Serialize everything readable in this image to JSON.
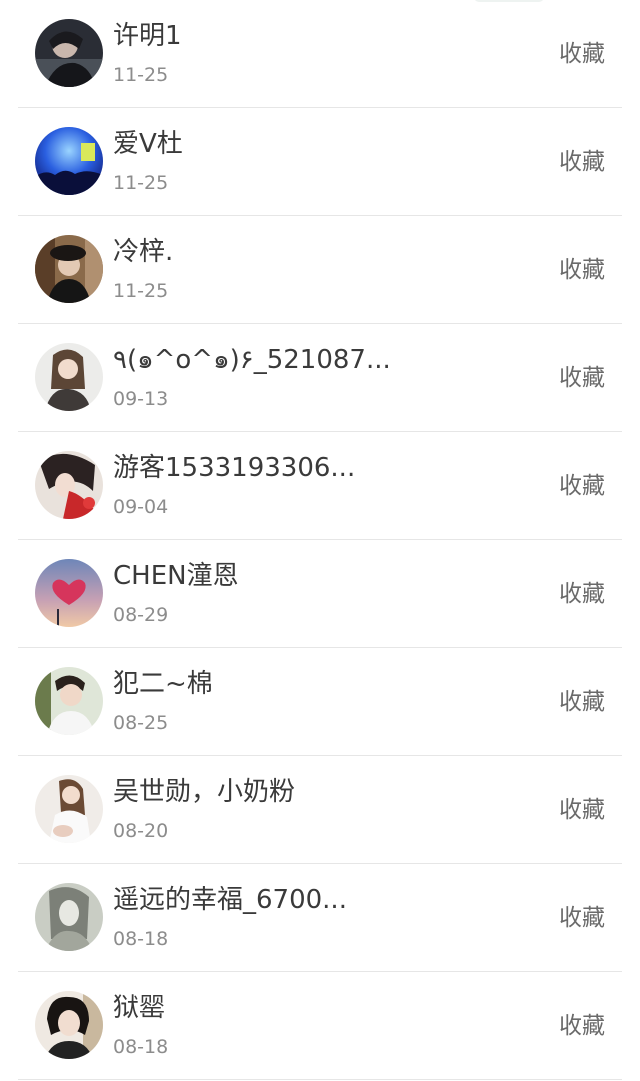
{
  "rows": [
    {
      "name": "许明1",
      "date": "11-25",
      "action": "收藏",
      "avatar": "avatar-dark-portrait"
    },
    {
      "name": "爱V杜",
      "date": "11-25",
      "action": "收藏",
      "avatar": "avatar-concert-blue"
    },
    {
      "name": "冷梓.",
      "date": "11-25",
      "action": "收藏",
      "avatar": "avatar-hat-portrait"
    },
    {
      "name": "٩(๑^o^๑)۶_521087...",
      "date": "09-13",
      "action": "收藏",
      "avatar": "avatar-girl-light"
    },
    {
      "name": "游客1533193306...",
      "date": "09-04",
      "action": "收藏",
      "avatar": "avatar-anime-red"
    },
    {
      "name": "CHEN潼恩",
      "date": "08-29",
      "action": "收藏",
      "avatar": "avatar-heart-cloud"
    },
    {
      "name": "犯二~棉",
      "date": "08-25",
      "action": "收藏",
      "avatar": "avatar-boy-white"
    },
    {
      "name": "吴世勋，小奶粉",
      "date": "08-20",
      "action": "收藏",
      "avatar": "avatar-girl-sitting"
    },
    {
      "name": "遥远的幸福_6700...",
      "date": "08-18",
      "action": "收藏",
      "avatar": "avatar-sketch-girl"
    },
    {
      "name": "狱罂",
      "date": "08-18",
      "action": "收藏",
      "avatar": "avatar-girl-shorthair"
    }
  ]
}
